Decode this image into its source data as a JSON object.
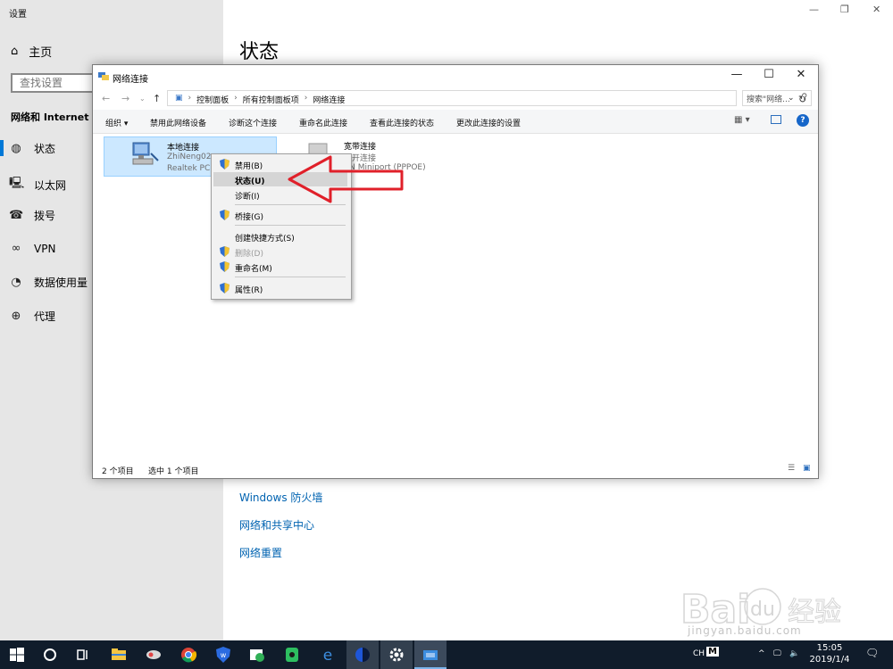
{
  "settings": {
    "window_title": "设置",
    "home": "主页",
    "search_placeholder": "查找设置",
    "section": "网络和 Internet",
    "nav": [
      "状态",
      "以太网",
      "拨号",
      "VPN",
      "数据使用量",
      "代理"
    ],
    "page_title": "状态",
    "links": [
      "Windows 防火墙",
      "网络和共享中心",
      "网络重置"
    ]
  },
  "net_window": {
    "title": "网络连接",
    "breadcrumbs": [
      "控制面板",
      "所有控制面板项",
      "网络连接"
    ],
    "search_placeholder": "搜索\"网络...",
    "commands": [
      "组织 ▾",
      "禁用此网络设备",
      "诊断这个连接",
      "重命名此连接",
      "查看此连接的状态",
      "更改此连接的设置"
    ],
    "items": [
      {
        "name": "本地连接",
        "line1": "ZhiNeng02",
        "line2": "Realtek PCI"
      },
      {
        "name": "宽带连接",
        "line1": "断开连接",
        "line2": "AN Miniport (PPPOE)"
      }
    ],
    "status_count": "2 个项目",
    "status_selected": "选中 1 个项目"
  },
  "context_menu": {
    "items": [
      {
        "label": "禁用(B)",
        "shield": true,
        "disabled": false
      },
      {
        "label": "状态(U)",
        "shield": false,
        "disabled": false,
        "highlight": true,
        "bold": true
      },
      {
        "label": "诊断(I)",
        "shield": false,
        "disabled": false
      },
      {
        "label": "桥接(G)",
        "shield": true,
        "disabled": false
      },
      {
        "label": "创建快捷方式(S)",
        "shield": false,
        "disabled": false
      },
      {
        "label": "删除(D)",
        "shield": true,
        "disabled": true
      },
      {
        "label": "重命名(M)",
        "shield": true,
        "disabled": false
      },
      {
        "label": "属性(R)",
        "shield": true,
        "disabled": false
      }
    ]
  },
  "taskbar": {
    "lang": "CH",
    "ime": "M",
    "time": "15:05",
    "date": "2019/1/4"
  },
  "watermark": {
    "text": "jingyan.baidu.com"
  },
  "colors": {
    "accent": "#0078d7",
    "arrow": "#e0202a",
    "taskbar": "#101c2b",
    "link": "#0063b1"
  }
}
